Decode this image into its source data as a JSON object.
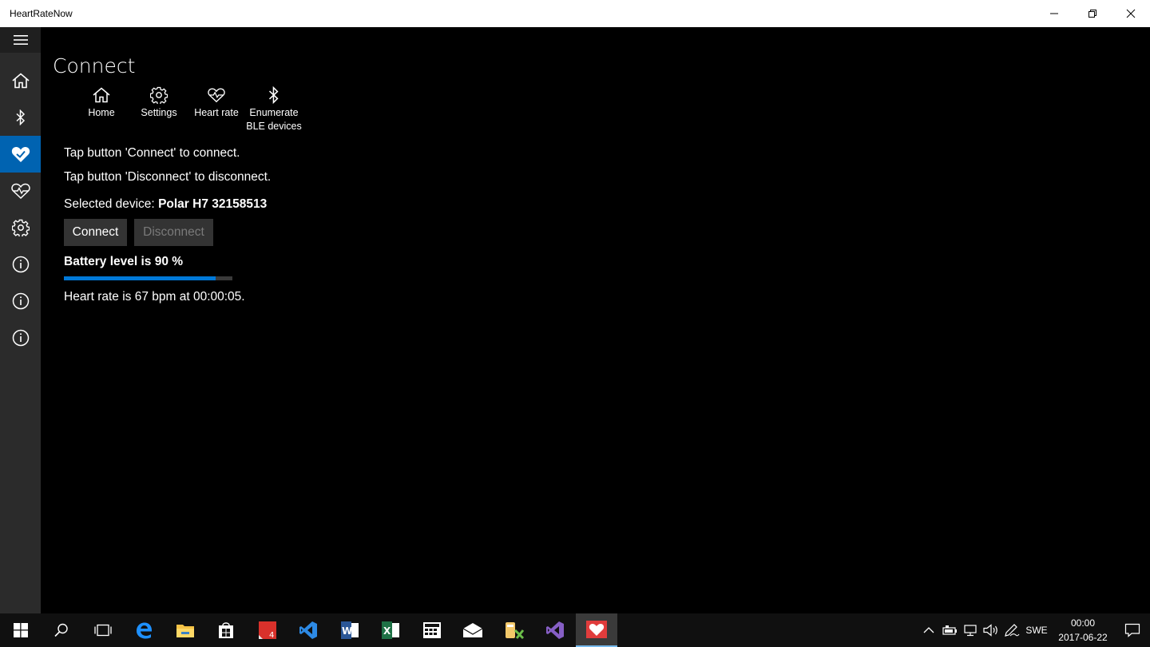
{
  "window": {
    "title": "HeartRateNow"
  },
  "page": {
    "title": "Connect"
  },
  "commands": [
    {
      "label": "Home",
      "icon": "home-icon"
    },
    {
      "label": "Settings",
      "icon": "gear-icon"
    },
    {
      "label": "Heart rate",
      "icon": "heart-icon"
    },
    {
      "label": "Enumerate BLE devices",
      "icon": "bluetooth-icon"
    }
  ],
  "instructions": {
    "connect": "Tap button 'Connect' to connect.",
    "disconnect": "Tap button 'Disconnect' to disconnect."
  },
  "device": {
    "label": "Selected device:",
    "name": "Polar H7 32158513"
  },
  "buttons": {
    "connect": "Connect",
    "disconnect": "Disconnect"
  },
  "battery": {
    "label": "Battery level is 90 %",
    "level_percent": 90
  },
  "heart_rate": {
    "text": "Heart rate is 67 bpm at 00:00:05."
  },
  "nav_rail": [
    {
      "icon": "hamburger-icon"
    },
    {
      "icon": "home-icon"
    },
    {
      "icon": "bluetooth-icon"
    },
    {
      "icon": "heart-check-icon",
      "selected": true
    },
    {
      "icon": "heart-icon"
    },
    {
      "icon": "gear-icon"
    },
    {
      "icon": "info-icon"
    },
    {
      "icon": "info-icon"
    },
    {
      "icon": "info-icon"
    }
  ],
  "taskbar": {
    "apps": [
      "start-icon",
      "search-icon",
      "task-view-icon",
      "edge-icon",
      "file-explorer-icon",
      "store-icon",
      "acrobat-icon",
      "vscode-icon",
      "word-icon",
      "excel-icon",
      "calculator-icon",
      "mail-icon",
      "app-icon",
      "visual-studio-icon",
      "heartratenow-icon"
    ],
    "language": "SWE",
    "time": "00:00",
    "date": "2017-06-22"
  },
  "colors": {
    "accent": "#0063b1",
    "progress": "#0078d7",
    "background": "#000000"
  }
}
